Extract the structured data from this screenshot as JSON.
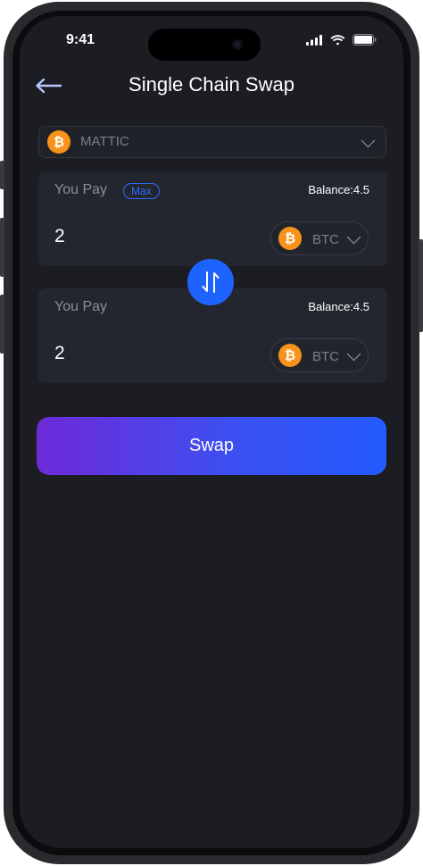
{
  "status_bar": {
    "time": "9:41"
  },
  "header": {
    "title": "Single Chain Swap",
    "back_icon": "arrow-left-icon"
  },
  "network": {
    "selected": "MATTIC",
    "icon": "bitcoin-icon",
    "icon_glyph": "₿"
  },
  "pay_cards": [
    {
      "label": "You Pay",
      "max_label": "Max",
      "balance": "Balance:4.5",
      "amount": "2",
      "token": "BTC",
      "token_icon_glyph": "₿"
    },
    {
      "label": "You Pay",
      "balance": "Balance:4.5",
      "amount": "2",
      "token": "BTC",
      "token_icon_glyph": "₿"
    }
  ],
  "swap_button": {
    "label": "Swap"
  },
  "colors": {
    "background": "#1c1d22",
    "card": "#24262f",
    "accent_blue": "#1f63ff",
    "btc_orange": "#f7931a",
    "gradient_start": "#6e2ad8",
    "gradient_end": "#235bff"
  }
}
